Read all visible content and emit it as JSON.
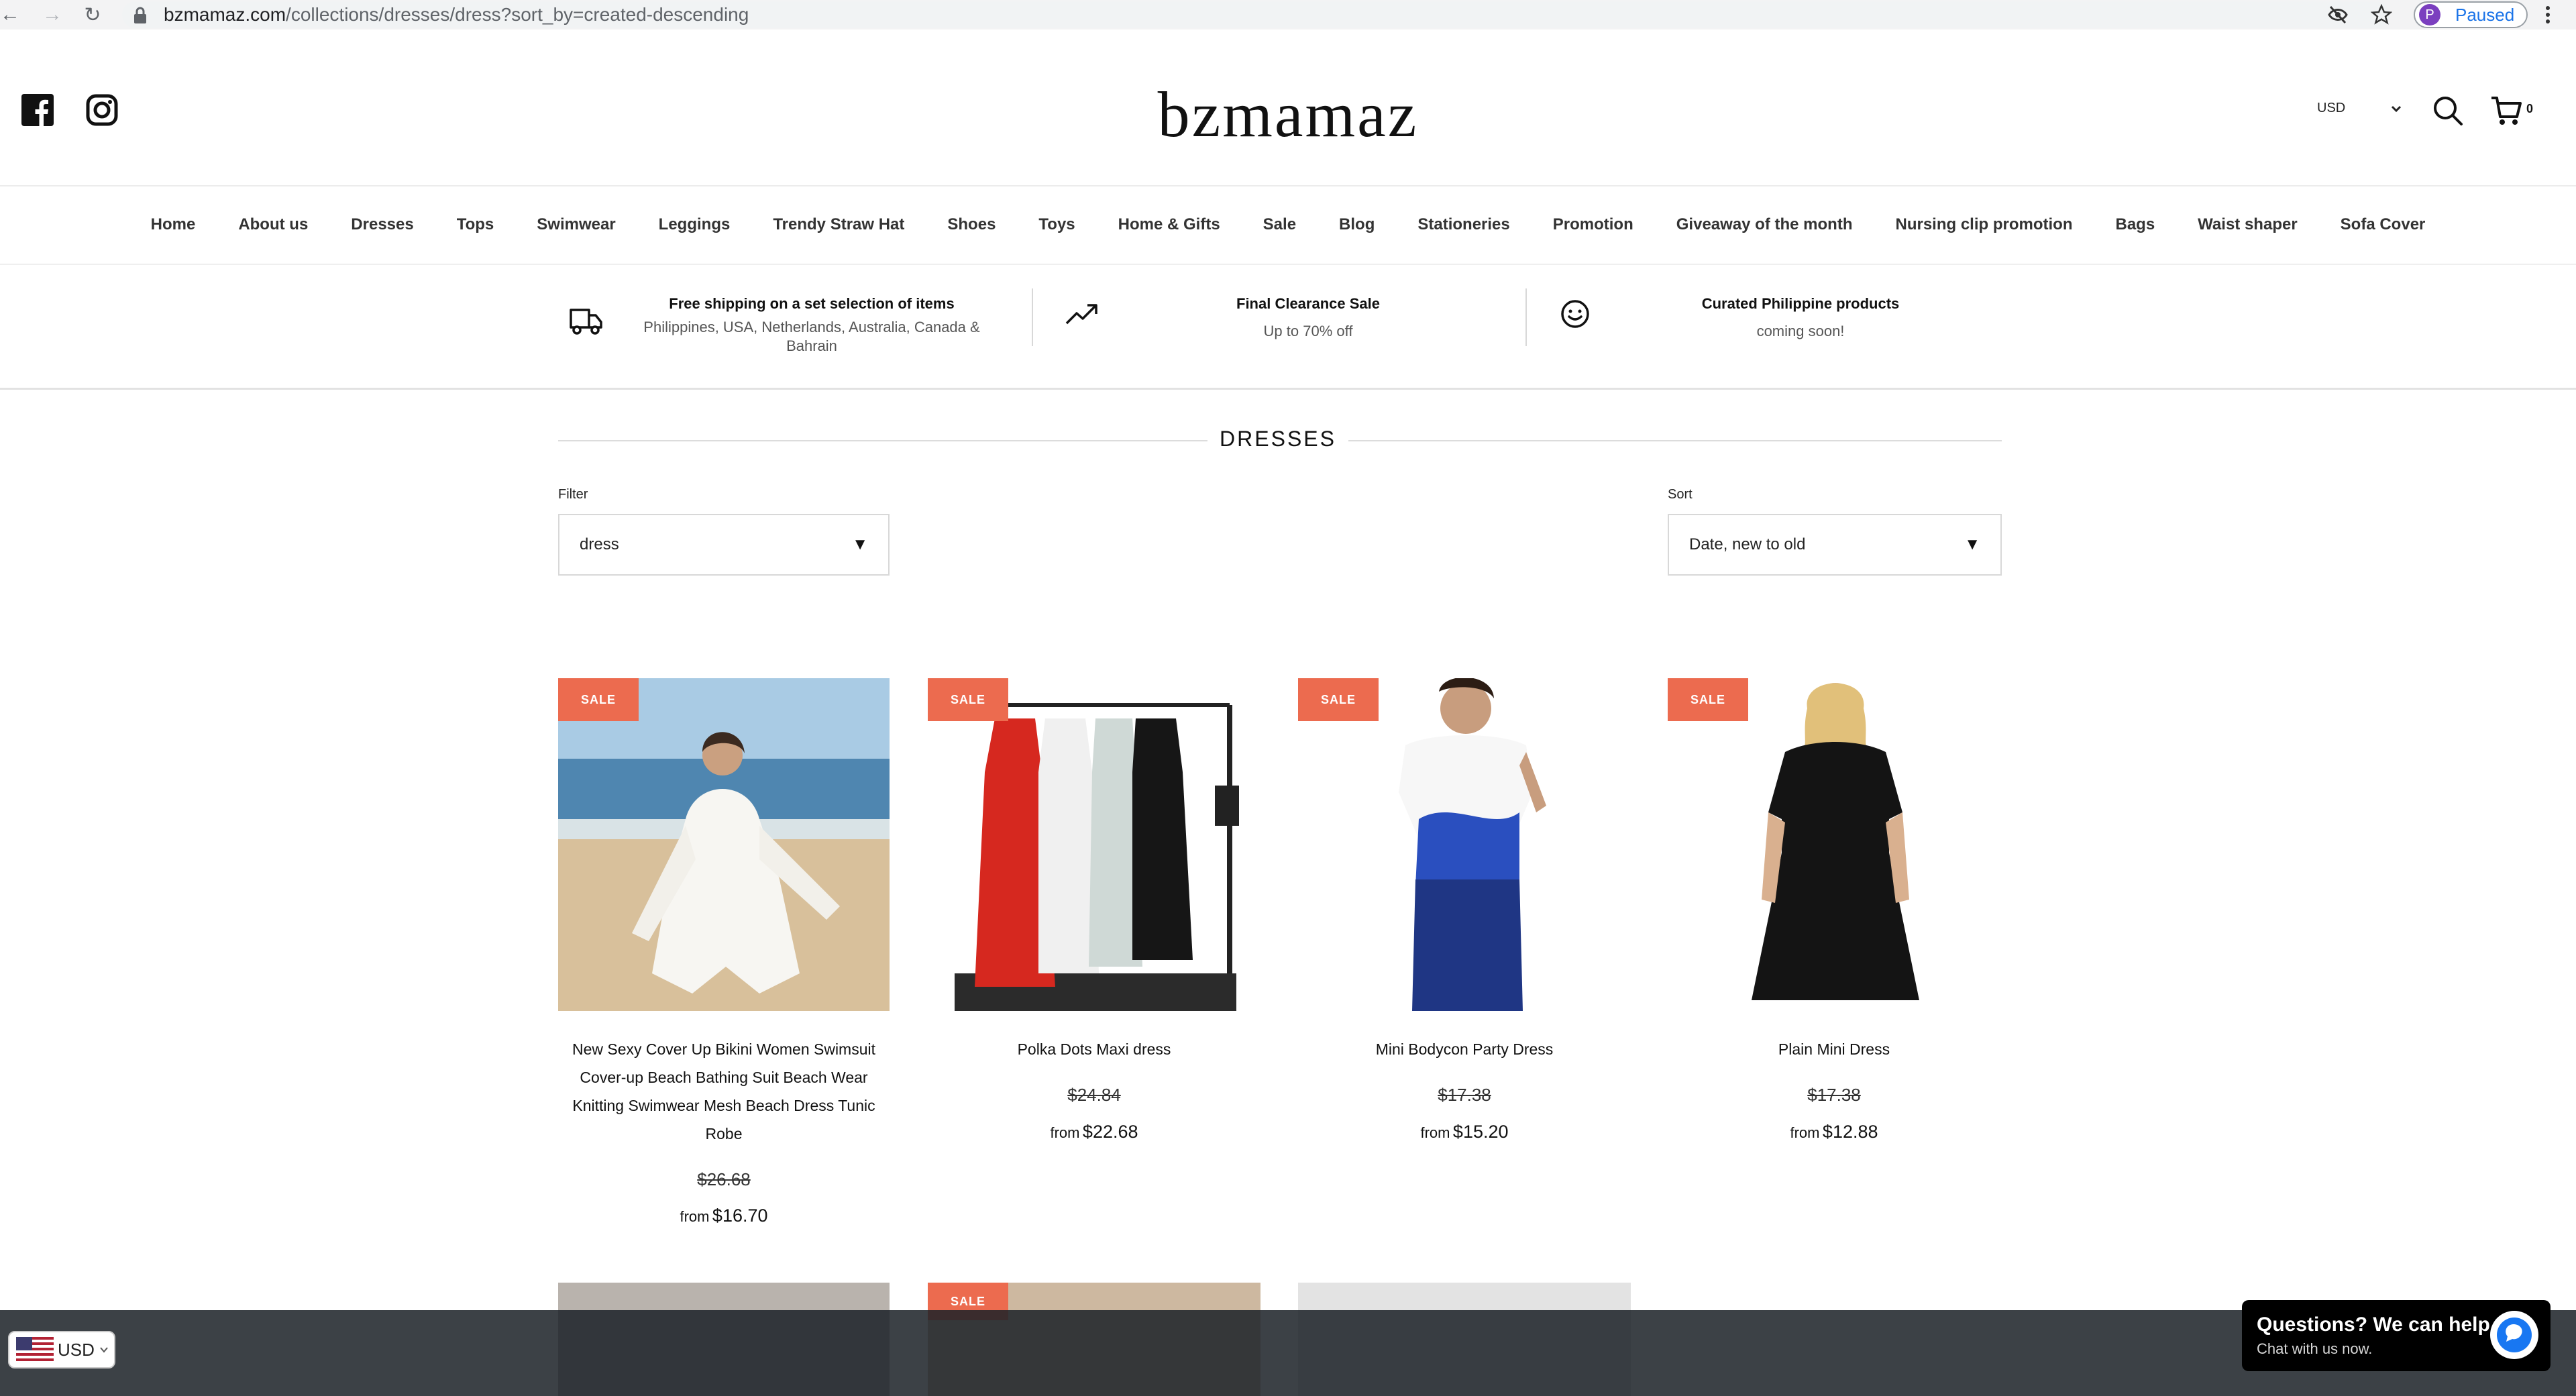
{
  "browser": {
    "url_host": "bzmamaz.com",
    "url_path": "/collections/dresses/dress?sort_by=created-descending",
    "profile_initial": "P",
    "profile_status": "Paused",
    "icons": [
      "back-icon",
      "forward-icon",
      "reload-icon",
      "lock-icon",
      "eye-off-icon",
      "star-icon",
      "kebab-menu-icon"
    ]
  },
  "header": {
    "logo": "bzmamaz",
    "currency": "USD",
    "cart_count": "0",
    "social_icons": [
      "facebook-icon",
      "instagram-icon"
    ]
  },
  "nav": {
    "items": [
      "Home",
      "About us",
      "Dresses",
      "Tops",
      "Swimwear",
      "Leggings",
      "Trendy Straw Hat",
      "Shoes",
      "Toys",
      "Home & Gifts",
      "Sale",
      "Blog",
      "Stationeries",
      "Promotion",
      "Giveaway of the month",
      "Nursing clip promotion",
      "Bags",
      "Waist shaper",
      "Sofa Cover"
    ]
  },
  "features": [
    {
      "icon": "truck-icon",
      "title": "Free shipping on a set selection of items",
      "subtitle": "Philippines, USA, Netherlands, Australia, Canada & Bahrain"
    },
    {
      "icon": "trending-up-icon",
      "title": "Final Clearance Sale",
      "subtitle": "Up to 70% off"
    },
    {
      "icon": "smiley-icon",
      "title": "Curated Philippine products",
      "subtitle": "coming soon!"
    }
  ],
  "collection": {
    "title": "DRESSES",
    "filter_label": "Filter",
    "filter_value": "dress",
    "sort_label": "Sort",
    "sort_value": "Date, new to old"
  },
  "products": [
    {
      "badge": "SALE",
      "name": "New Sexy Cover Up Bikini Women Swimsuit Cover-up Beach Bathing Suit Beach Wear Knitting Swimwear Mesh Beach Dress Tunic Robe",
      "was": "$26.68",
      "from_label": "from",
      "price": "$16.70"
    },
    {
      "badge": "SALE",
      "name": "Polka Dots Maxi dress",
      "was": "$24.84",
      "from_label": "from",
      "price": "$22.68"
    },
    {
      "badge": "SALE",
      "name": "Mini Bodycon Party Dress",
      "was": "$17.38",
      "from_label": "from",
      "price": "$15.20"
    },
    {
      "badge": "SALE",
      "name": "Plain Mini Dress",
      "was": "$17.38",
      "from_label": "from",
      "price": "$12.88"
    }
  ],
  "second_row": {
    "badge": "SALE"
  },
  "widgets": {
    "currency": "USD",
    "chat_title": "Questions? We can help.",
    "chat_subtitle": "Chat with us now."
  },
  "colors": {
    "sale_badge": "#ec6b4f",
    "overlay": "#1c2228",
    "link_blue": "#1a73e8",
    "chat_icon": "#1877f2"
  }
}
